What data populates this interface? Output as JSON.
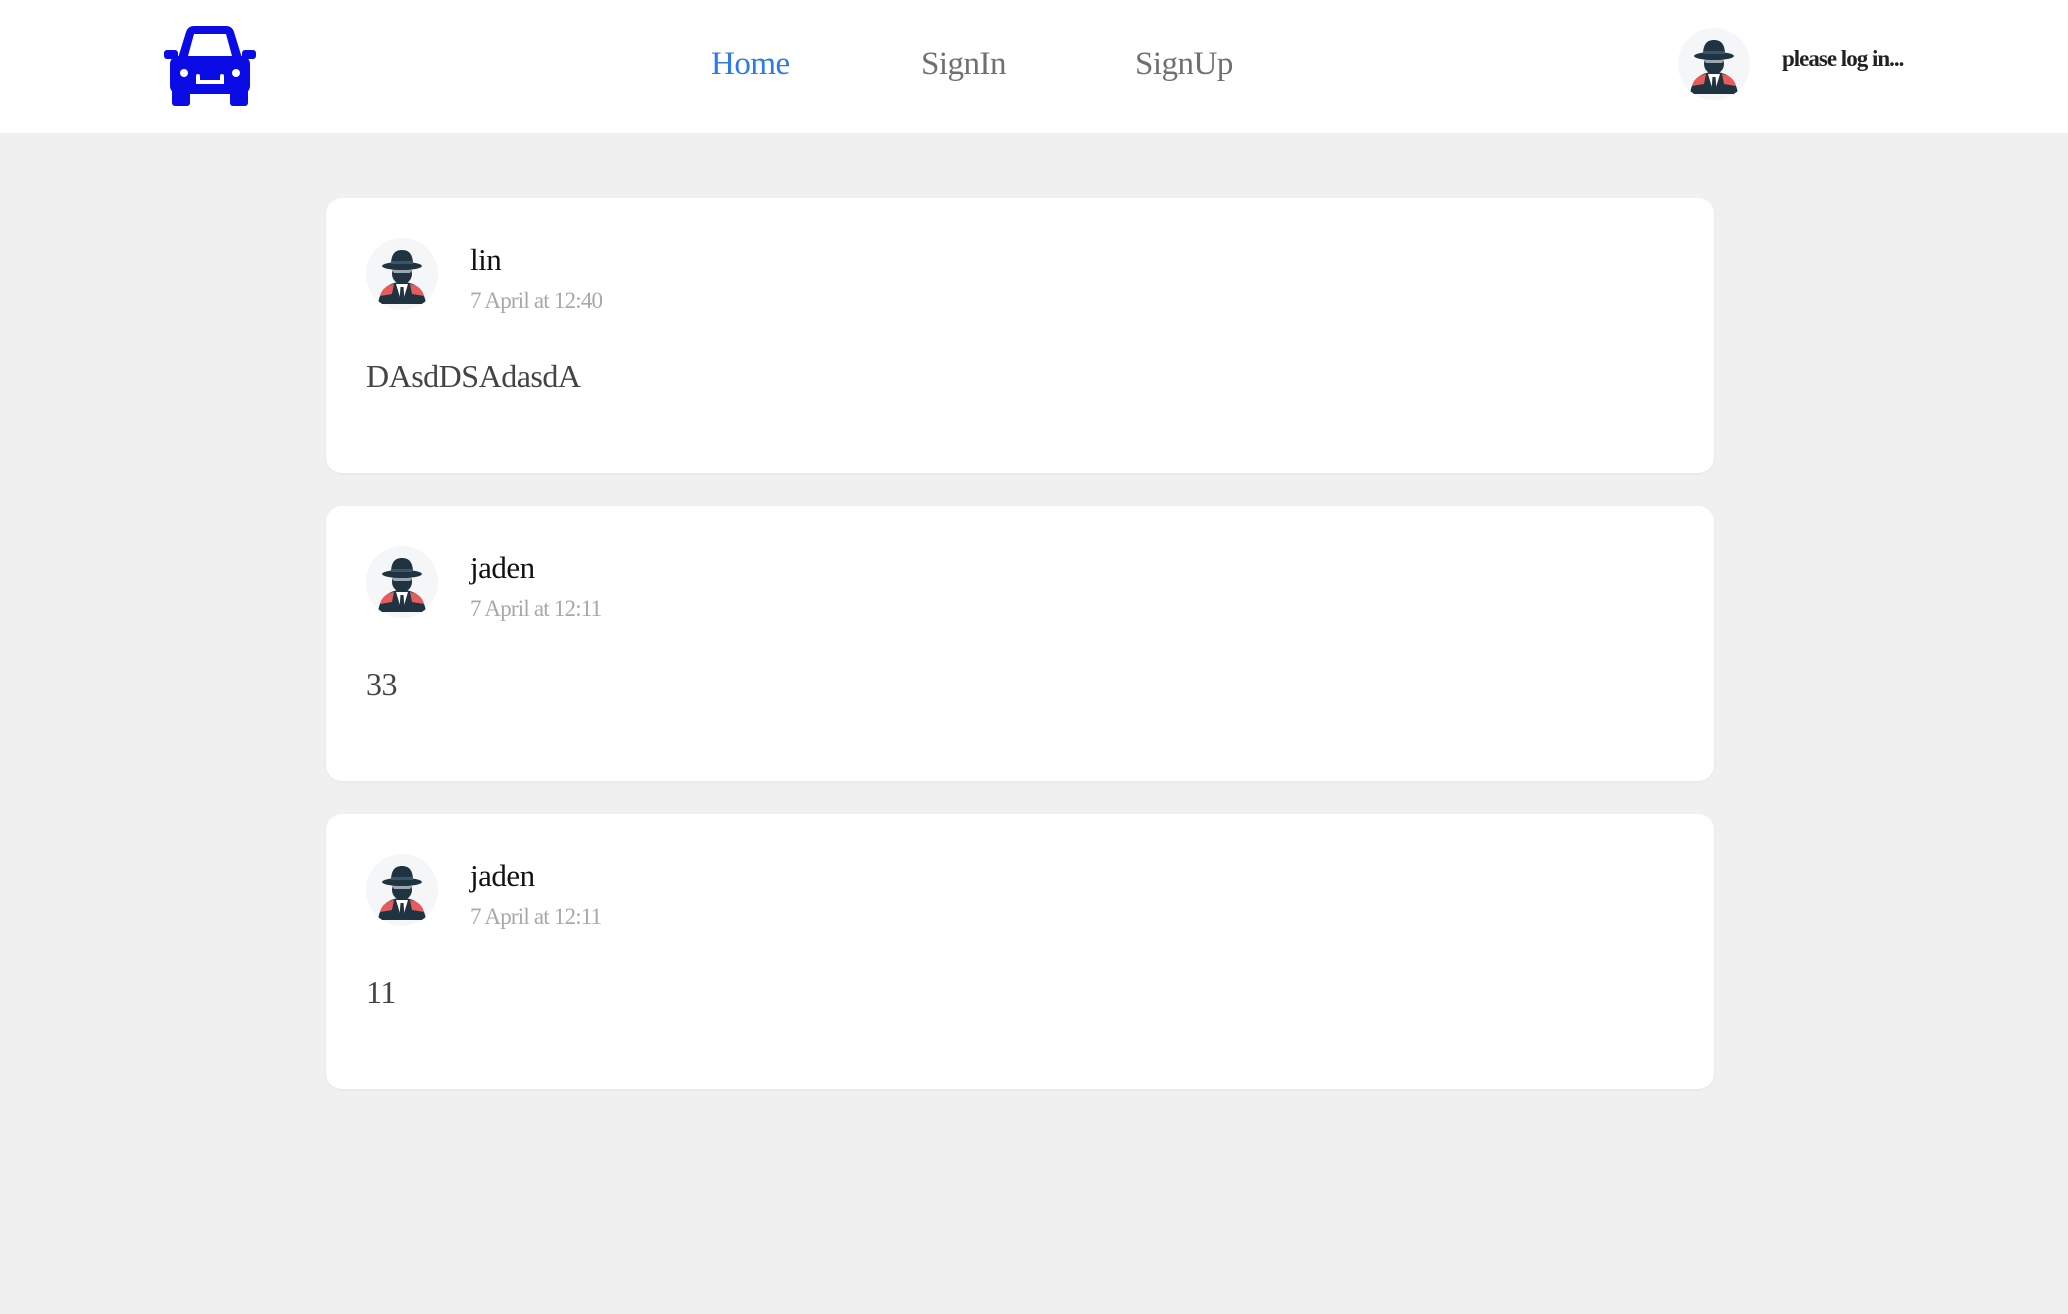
{
  "header": {
    "logo_icon": "car-icon",
    "logo_color": "#0b0be6",
    "nav": [
      {
        "label": "Home",
        "active": true
      },
      {
        "label": "SignIn",
        "active": false
      },
      {
        "label": "SignUp",
        "active": false
      }
    ],
    "avatar_icon": "spy-avatar-icon",
    "login_prompt": "please log in..."
  },
  "colors": {
    "active_nav": "#2d7be6",
    "page_bg": "#f0f0f0"
  },
  "posts": [
    {
      "author": "lin",
      "time": "7 April at 12:40",
      "content": "DAsdDSAdasdA",
      "avatar_icon": "spy-avatar-icon"
    },
    {
      "author": "jaden",
      "time": "7 April at 12:11",
      "content": "33",
      "avatar_icon": "spy-avatar-icon"
    },
    {
      "author": "jaden",
      "time": "7 April at 12:11",
      "content": "11",
      "avatar_icon": "spy-avatar-icon"
    }
  ]
}
